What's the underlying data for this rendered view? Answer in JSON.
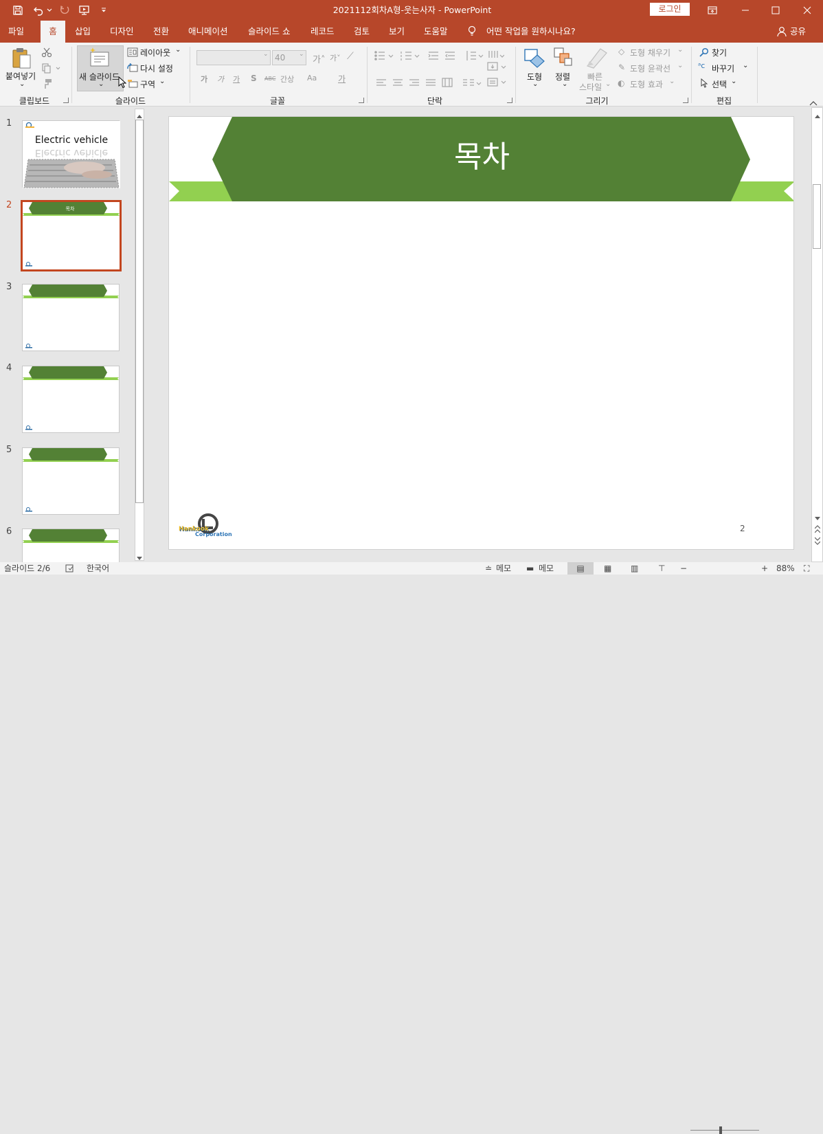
{
  "app": {
    "doc_title": "2021112회차A형-웃는사자  -  PowerPoint",
    "login": "로그인"
  },
  "tabs": [
    {
      "label": "파일"
    },
    {
      "label": "홈"
    },
    {
      "label": "삽입"
    },
    {
      "label": "디자인"
    },
    {
      "label": "전환"
    },
    {
      "label": "애니메이션"
    },
    {
      "label": "슬라이드 쇼"
    },
    {
      "label": "레코드"
    },
    {
      "label": "검토"
    },
    {
      "label": "보기"
    },
    {
      "label": "도움말"
    }
  ],
  "tell_me": "어떤 작업을 원하시나요?",
  "share": "공유",
  "ribbon": {
    "clipboard": {
      "paste": "붙여넣기",
      "group": "클립보드"
    },
    "slides": {
      "new_slide": "새 슬라이드",
      "layout": "레이아웃",
      "reset": "다시 설정",
      "section": "구역",
      "group": "슬라이드"
    },
    "font": {
      "size": "40",
      "group": "글꼴",
      "bold": "가",
      "italic": "가",
      "underline": "가",
      "strike": "S",
      "abc": "ABC",
      "spacing": "간상",
      "case": "Aa",
      "color": "가"
    },
    "paragraph": {
      "group": "단락"
    },
    "drawing": {
      "shapes": "도형",
      "arrange": "정렬",
      "quick_styles_1": "빠른",
      "quick_styles_2": "스타일",
      "fill": "도형 채우기",
      "outline": "도형 윤곽선",
      "effects": "도형 효과",
      "group": "그리기"
    },
    "editing": {
      "find": "찾기",
      "replace": "바꾸기",
      "select": "선택",
      "group": "편집"
    }
  },
  "thumbnails": [
    {
      "num": "1",
      "title": "Electric vehicle",
      "reflect": "Electric vehicle"
    },
    {
      "num": "2",
      "title": "목차"
    },
    {
      "num": "3"
    },
    {
      "num": "4"
    },
    {
      "num": "5"
    },
    {
      "num": "6"
    }
  ],
  "slide": {
    "title": "목차",
    "page": "2",
    "logo_1": "Hankook",
    "logo_2": "Corporation"
  },
  "status": {
    "slide_pos": "슬라이드 2/6",
    "language": "한국어",
    "notes": "메모",
    "comments": "메모",
    "zoom": "88%"
  },
  "colors": {
    "brand": "#b7472a",
    "banner_dark": "#538135",
    "banner_light": "#92d050",
    "thumb_sel": "#c3461f"
  }
}
